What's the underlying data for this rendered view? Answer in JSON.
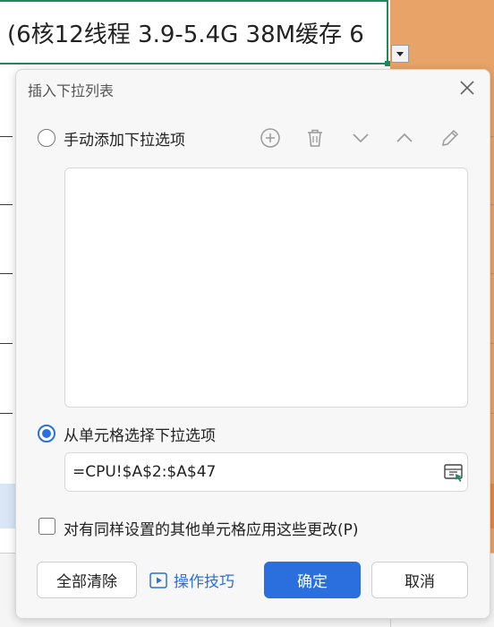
{
  "sheet": {
    "active_cell_text": "(6核12线程 3.9-5.4G 38M缓存 6"
  },
  "dialog": {
    "title": "插入下拉列表",
    "manual_option_label": "手动添加下拉选项",
    "manual_items": [],
    "cell_option_label": "从单元格选择下拉选项",
    "source_value": "=CPU!$A$2:$A$47",
    "apply_all_label": "对有同样设置的其他单元格应用这些更改(P)",
    "clear_all_label": "全部清除",
    "tips_label": "操作技巧",
    "ok_label": "确定",
    "cancel_label": "取消",
    "selected_option": "cell"
  },
  "colors": {
    "accent": "#2b6fde",
    "cell_border": "#1f8a5a",
    "column_fill": "#e8a368"
  }
}
